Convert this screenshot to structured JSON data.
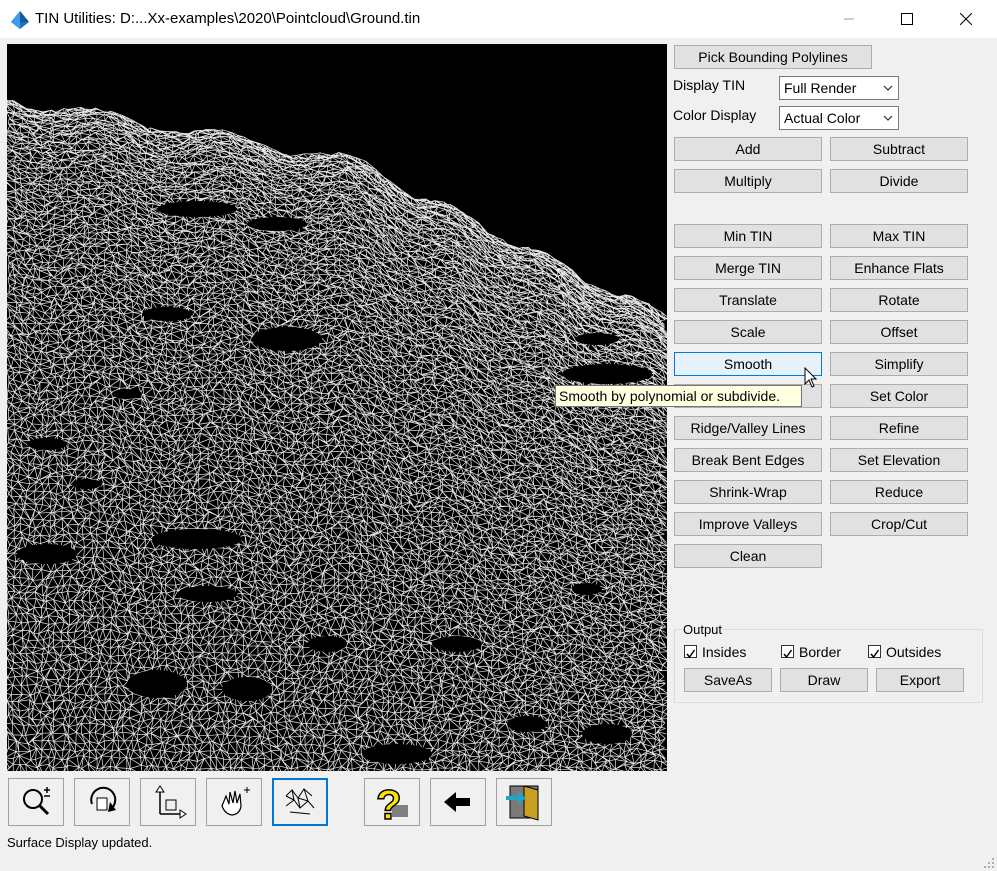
{
  "window": {
    "title": "TIN Utilities: D:...Xx-examples\\2020\\Pointcloud\\Ground.tin",
    "app_icon": "tin-pyramid-icon",
    "controls": [
      "minimize-icon",
      "maximize-icon",
      "close-icon"
    ]
  },
  "panel": {
    "pick_bounding": "Pick Bounding Polylines",
    "display_tin_label": "Display TIN",
    "display_tin_value": "Full Render",
    "color_display_label": "Color Display",
    "color_display_value": "Actual Color",
    "buttons": {
      "add": "Add",
      "subtract": "Subtract",
      "multiply": "Multiply",
      "divide": "Divide",
      "min_tin": "Min TIN",
      "max_tin": "Max TIN",
      "merge_tin": "Merge TIN",
      "enhance_flats": "Enhance Flats",
      "translate": "Translate",
      "rotate": "Rotate",
      "scale": "Scale",
      "offset": "Offset",
      "smooth": "Smooth",
      "simplify": "Simplify",
      "set_color": "Set Color",
      "ridge_valley": "Ridge/Valley Lines",
      "refine": "Refine",
      "break_bent_edges": "Break Bent Edges",
      "set_elevation": "Set Elevation",
      "shrink_wrap": "Shrink-Wrap",
      "reduce": "Reduce",
      "improve_valleys": "Improve Valleys",
      "crop_cut": "Crop/Cut",
      "clean": "Clean"
    }
  },
  "output": {
    "legend": "Output",
    "insides": {
      "label": "Insides",
      "checked": true
    },
    "border": {
      "label": "Border",
      "checked": true
    },
    "outsides": {
      "label": "Outsides",
      "checked": true
    },
    "saveas": "SaveAs",
    "draw": "Draw",
    "export": "Export"
  },
  "tooltip": "Smooth by polynomial or subdivide.",
  "toolbar": [
    "zoom-icon",
    "rotate-view-icon",
    "pan-axes-icon",
    "hand-pan-icon",
    "mesh-display-icon",
    "help-icon",
    "back-arrow-icon",
    "exit-door-icon"
  ],
  "status": "Surface Display updated."
}
